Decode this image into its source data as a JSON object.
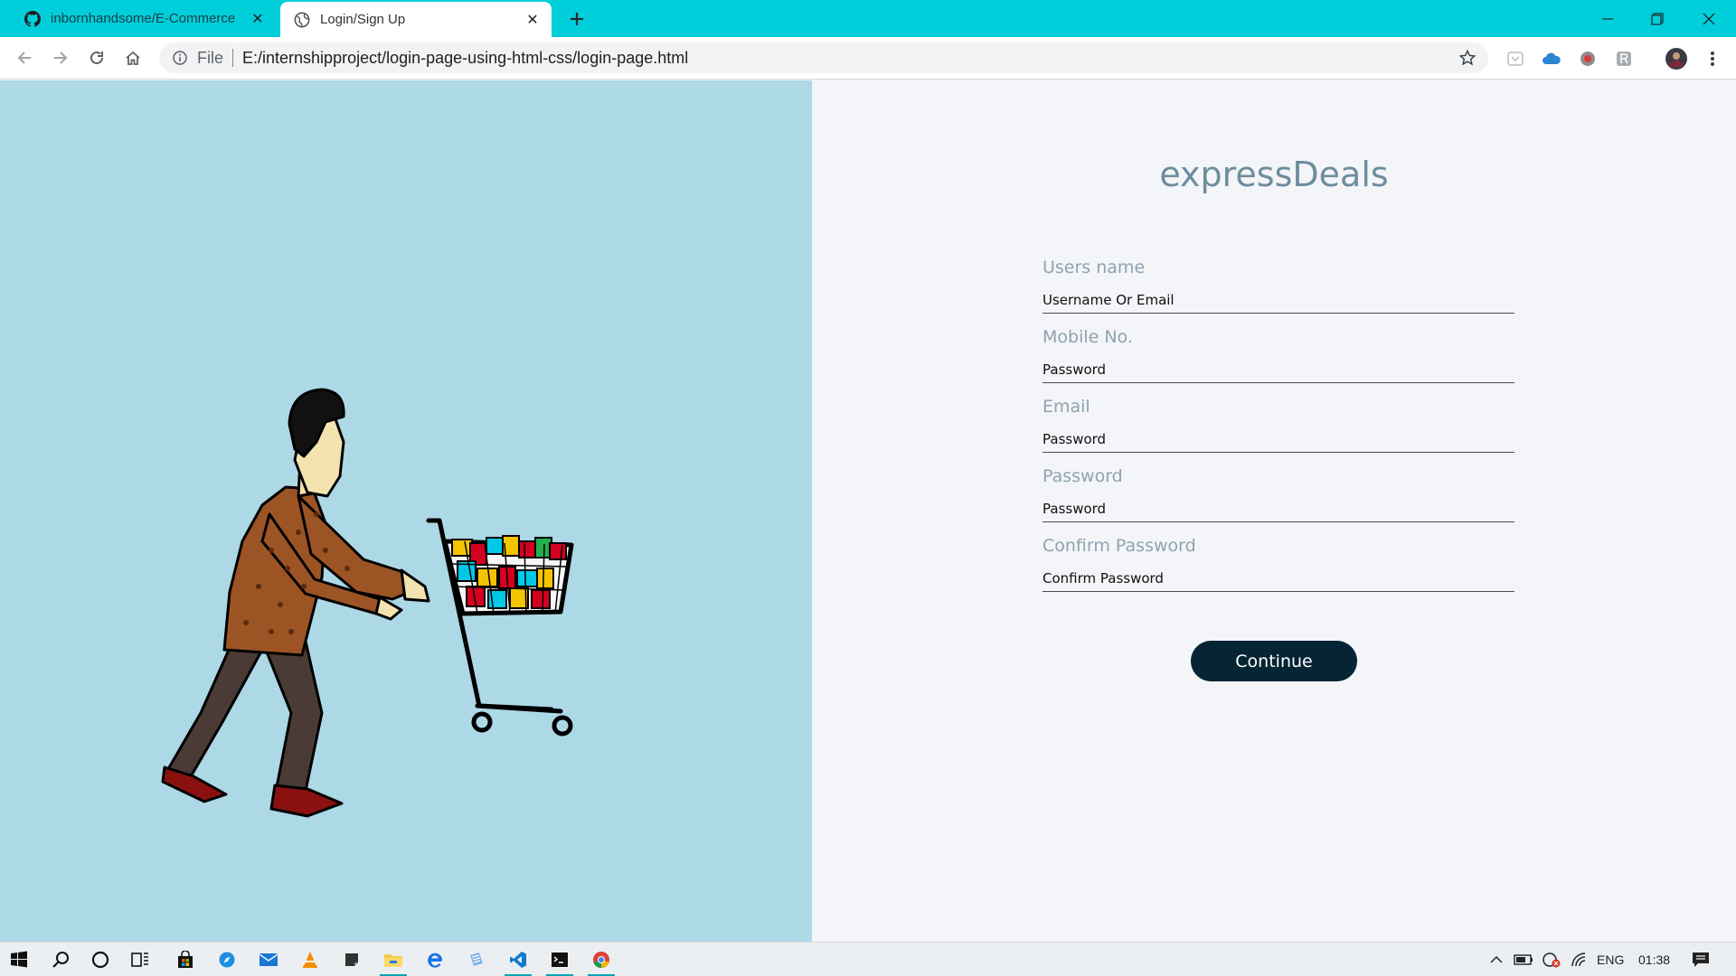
{
  "browser": {
    "tabs": [
      {
        "title": "inbornhandsome/E-Commerce",
        "icon": "github-icon"
      },
      {
        "title": "Login/Sign Up",
        "icon": "globe-icon"
      }
    ],
    "address": {
      "scheme": "File",
      "url": "E:/internshipproject/login-page-using-html-css/login-page.html"
    },
    "accent": "#00cfdb"
  },
  "page": {
    "brand": "expressDeals",
    "fields": [
      {
        "label": "Users name",
        "placeholder": "Username Or Email"
      },
      {
        "label": "Mobile No.",
        "placeholder": "Password"
      },
      {
        "label": "Email",
        "placeholder": "Password"
      },
      {
        "label": "Password",
        "placeholder": "Password"
      },
      {
        "label": "Confirm Password",
        "placeholder": "Confirm Password"
      }
    ],
    "continue_label": "Continue",
    "left_bg": "#add8e6",
    "button_bg": "#052535"
  },
  "taskbar": {
    "language": "ENG",
    "time": "01:38"
  }
}
